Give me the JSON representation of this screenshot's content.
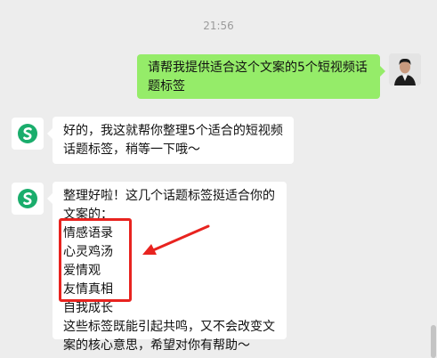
{
  "timestamp": "21:56",
  "messages": {
    "user": {
      "lines": [
        "请帮我提供适合这个文案的5个短视频话",
        "题标签"
      ]
    },
    "bot_reply_1": {
      "lines": [
        "好的，我这就帮你整理5个适合的短视频",
        "话题标签，稍等一下哦～"
      ]
    },
    "bot_reply_2": {
      "intro_lines": [
        "整理好啦！这几个话题标签挺适合你的",
        "文案的："
      ],
      "tags": [
        "情感语录",
        "心灵鸡汤",
        "爱情观",
        "友情真相",
        "自我成长"
      ],
      "outro_lines": [
        "这些标签既能引起共鸣，又不会改变文",
        "案的核心意思，希望对你有帮助～"
      ]
    }
  },
  "icons": {
    "bot_avatar": "assistant-logo-icon",
    "user_avatar": "user-photo-avatar"
  },
  "colors": {
    "background": "#ededed",
    "my_bubble": "#95ec69",
    "bot_bubble": "#ffffff",
    "highlight": "#e8231f",
    "logo": "#1aad6c"
  }
}
